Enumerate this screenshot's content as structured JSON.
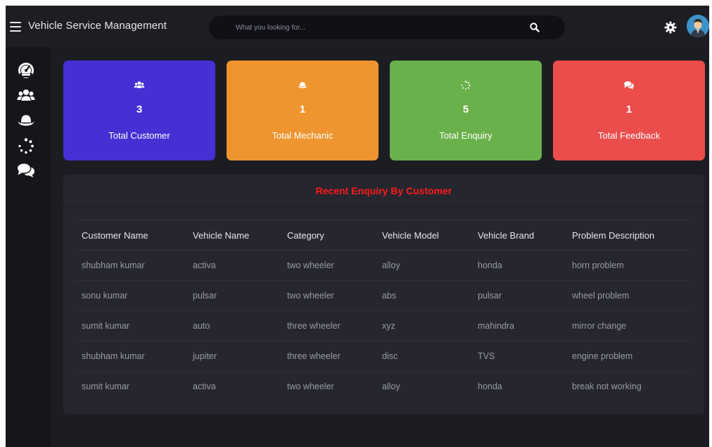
{
  "header": {
    "title": "Vehicle Service Management",
    "search_placeholder": "What you looking for...",
    "icons": {
      "menu": "hamburger-icon",
      "search": "search-icon",
      "settings": "gear-icon",
      "profile": "avatar"
    }
  },
  "sidebar": {
    "items": [
      {
        "icon": "dashboard-icon"
      },
      {
        "icon": "users-icon"
      },
      {
        "icon": "mechanic-hat-icon"
      },
      {
        "icon": "spinner-icon"
      },
      {
        "icon": "comments-icon"
      }
    ]
  },
  "cards": [
    {
      "count": "3",
      "label": "Total Customer",
      "color": "#4630d4",
      "icon": "users-icon"
    },
    {
      "count": "1",
      "label": "Total Mechanic",
      "color": "#ee9530",
      "icon": "mechanic-hat-icon"
    },
    {
      "count": "5",
      "label": "Total Enquiry",
      "color": "#6ab14b",
      "icon": "spinner-icon"
    },
    {
      "count": "1",
      "label": "Total Feedback",
      "color": "#ea4d4b",
      "icon": "comments-icon"
    }
  ],
  "enquiry": {
    "title": "Recent Enquiry By Customer",
    "title_color": "#ff1a1a",
    "columns": [
      "Customer Name",
      "Vehicle Name",
      "Category",
      "Vehicle Model",
      "Vehicle Brand",
      "Problem Description"
    ],
    "rows": [
      [
        "shubham kumar",
        "activa",
        "two wheeler",
        "alloy",
        "honda",
        "horn problem"
      ],
      [
        "sonu kumar",
        "pulsar",
        "two wheeler",
        "abs",
        "pulsar",
        "wheel problem"
      ],
      [
        "sumit kumar",
        "auto",
        "three wheeler",
        "xyz",
        "mahindra",
        "mirror change"
      ],
      [
        "shubham kumar",
        "jupiter",
        "three wheeler",
        "disc",
        "TVS",
        "engine problem"
      ],
      [
        "sumit kumar",
        "activa",
        "two wheeler",
        "alloy",
        "honda",
        "break not working"
      ]
    ]
  }
}
